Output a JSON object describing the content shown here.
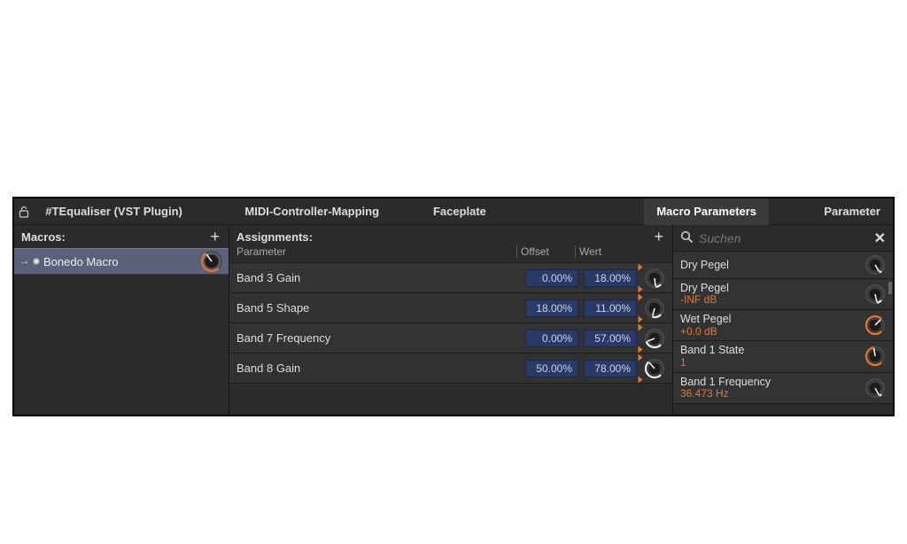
{
  "tabs": {
    "plugin_name": "#TEqualiser (VST Plugin)",
    "midi": "MIDI-Controller-Mapping",
    "faceplate": "Faceplate",
    "macro_params": "Macro Parameters",
    "parameter": "Parameter"
  },
  "macros": {
    "title": "Macros:",
    "items": [
      {
        "label": "Bonedo Macro",
        "arc_pct": 70
      }
    ]
  },
  "assignments": {
    "title": "Assignments:",
    "columns": {
      "parameter": "Parameter",
      "offset": "Offset",
      "wert": "Wert"
    },
    "rows": [
      {
        "param": "Band 3 Gain",
        "offset": "0.00%",
        "wert": "18.00%",
        "arc_pct": 14
      },
      {
        "param": "Band 5 Shape",
        "offset": "18.00%",
        "wert": "11.00%",
        "arc_pct": 22
      },
      {
        "param": "Band 7 Frequency",
        "offset": "0.00%",
        "wert": "57.00%",
        "arc_pct": 42
      },
      {
        "param": "Band 8 Gain",
        "offset": "50.00%",
        "wert": "78.00%",
        "arc_pct": 68
      }
    ]
  },
  "param_search": {
    "placeholder": "Suchen",
    "items": [
      {
        "name": "Dry Pegel",
        "value": "",
        "arc_pct": 5
      },
      {
        "name": "Dry Pegel",
        "value": "-INF dB",
        "arc_pct": 12
      },
      {
        "name": "Wet Pegel",
        "value": "+0.0 dB",
        "arc_pct": 100
      },
      {
        "name": "Band 1 State",
        "value": "1",
        "arc_pct": 80
      },
      {
        "name": "Band 1 Frequency",
        "value": "36.473 Hz",
        "arc_pct": 6
      }
    ]
  }
}
